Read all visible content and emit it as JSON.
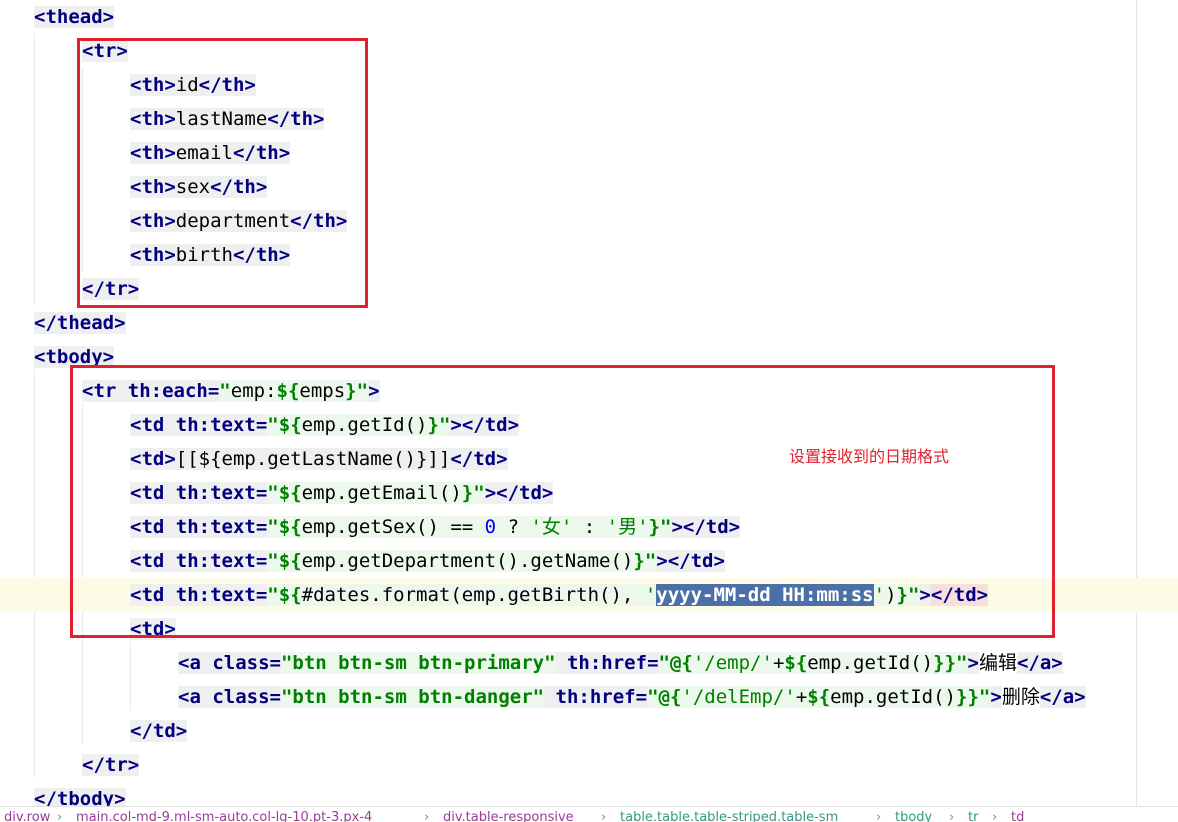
{
  "editor": {
    "annotation": "设置接收到的日期格式",
    "lines": [
      {
        "tokens": [
          {
            "t": "<thead>",
            "c": "tg"
          }
        ]
      },
      {
        "tokens": [
          {
            "t": "<tr>",
            "c": "tg"
          }
        ]
      },
      {
        "tokens": [
          {
            "t": "<th>",
            "c": "tg"
          },
          {
            "t": "id",
            "c": "pt"
          },
          {
            "t": "</th>",
            "c": "tg"
          }
        ]
      },
      {
        "tokens": [
          {
            "t": "<th>",
            "c": "tg"
          },
          {
            "t": "lastName",
            "c": "pt"
          },
          {
            "t": "</th>",
            "c": "tg"
          }
        ]
      },
      {
        "tokens": [
          {
            "t": "<th>",
            "c": "tg"
          },
          {
            "t": "email",
            "c": "pt"
          },
          {
            "t": "</th>",
            "c": "tg"
          }
        ]
      },
      {
        "tokens": [
          {
            "t": "<th>",
            "c": "tg"
          },
          {
            "t": "sex",
            "c": "pt"
          },
          {
            "t": "</th>",
            "c": "tg"
          }
        ]
      },
      {
        "tokens": [
          {
            "t": "<th>",
            "c": "tg"
          },
          {
            "t": "department",
            "c": "pt"
          },
          {
            "t": "</th>",
            "c": "tg"
          }
        ]
      },
      {
        "tokens": [
          {
            "t": "<th>",
            "c": "tg"
          },
          {
            "t": "birth",
            "c": "pt"
          },
          {
            "t": "</th>",
            "c": "tg"
          }
        ]
      },
      {
        "tokens": [
          {
            "t": "</tr>",
            "c": "tg"
          }
        ]
      },
      {
        "tokens": [
          {
            "t": "</thead>",
            "c": "tg"
          }
        ]
      },
      {
        "tokens": [
          {
            "t": "<tbody>",
            "c": "tg"
          }
        ]
      },
      {
        "tokens": [
          {
            "t": "<tr ",
            "c": "tg"
          },
          {
            "t": "th:each",
            "c": "at"
          },
          {
            "t": "=",
            "c": "at"
          },
          {
            "t": "\"",
            "c": "st"
          },
          {
            "t": "emp:",
            "c": "ex"
          },
          {
            "t": "${",
            "c": "st"
          },
          {
            "t": "emps",
            "c": "ex"
          },
          {
            "t": "}",
            "c": "st"
          },
          {
            "t": "\"",
            "c": "st"
          },
          {
            "t": ">",
            "c": "tg"
          }
        ]
      },
      {
        "tokens": [
          {
            "t": "<td ",
            "c": "tg"
          },
          {
            "t": "th:text",
            "c": "at"
          },
          {
            "t": "=",
            "c": "at"
          },
          {
            "t": "\"",
            "c": "st"
          },
          {
            "t": "${",
            "c": "st"
          },
          {
            "t": "emp.getId()",
            "c": "ex"
          },
          {
            "t": "}",
            "c": "st"
          },
          {
            "t": "\"",
            "c": "st"
          },
          {
            "t": "></td>",
            "c": "tg"
          }
        ]
      },
      {
        "tokens": [
          {
            "t": "<td>",
            "c": "tg"
          },
          {
            "t": "[[${emp.getLastName()}]]",
            "c": "pt"
          },
          {
            "t": "</td>",
            "c": "tg"
          }
        ]
      },
      {
        "tokens": [
          {
            "t": "<td ",
            "c": "tg"
          },
          {
            "t": "th:text",
            "c": "at"
          },
          {
            "t": "=",
            "c": "at"
          },
          {
            "t": "\"",
            "c": "st"
          },
          {
            "t": "${",
            "c": "st"
          },
          {
            "t": "emp.getEmail()",
            "c": "ex"
          },
          {
            "t": "}",
            "c": "st"
          },
          {
            "t": "\"",
            "c": "st"
          },
          {
            "t": "></td>",
            "c": "tg"
          }
        ]
      },
      {
        "tokens": [
          {
            "t": "<td ",
            "c": "tg"
          },
          {
            "t": "th:text",
            "c": "at"
          },
          {
            "t": "=",
            "c": "at"
          },
          {
            "t": "\"",
            "c": "st"
          },
          {
            "t": "${",
            "c": "st"
          },
          {
            "t": "emp.getSex() == ",
            "c": "ex"
          },
          {
            "t": "0",
            "c": "nm"
          },
          {
            "t": " ? ",
            "c": "ex"
          },
          {
            "t": "'女'",
            "c": "ch"
          },
          {
            "t": " : ",
            "c": "ex"
          },
          {
            "t": "'男'",
            "c": "ch"
          },
          {
            "t": "}",
            "c": "st"
          },
          {
            "t": "\"",
            "c": "st"
          },
          {
            "t": "></td>",
            "c": "tg"
          }
        ]
      },
      {
        "tokens": [
          {
            "t": "<td ",
            "c": "tg"
          },
          {
            "t": "th:text",
            "c": "at"
          },
          {
            "t": "=",
            "c": "at"
          },
          {
            "t": "\"",
            "c": "st"
          },
          {
            "t": "${",
            "c": "st"
          },
          {
            "t": "emp.getDepartment().getName()",
            "c": "ex"
          },
          {
            "t": "}",
            "c": "st"
          },
          {
            "t": "\"",
            "c": "st"
          },
          {
            "t": "></td>",
            "c": "tg"
          }
        ]
      },
      {
        "tokens": [
          {
            "t": "<td ",
            "c": "tg"
          },
          {
            "t": "th:text",
            "c": "at"
          },
          {
            "t": "=",
            "c": "at"
          },
          {
            "t": "\"",
            "c": "st"
          },
          {
            "t": "${",
            "c": "st"
          },
          {
            "t": "#dates.format(emp.getBirth(), ",
            "c": "ex"
          },
          {
            "t": "'",
            "c": "ch"
          },
          {
            "t": "yyyy-MM-dd HH:mm:ss",
            "c": "sel"
          },
          {
            "t": "'",
            "c": "ch"
          },
          {
            "t": ")",
            "c": "ex"
          },
          {
            "t": "}",
            "c": "st"
          },
          {
            "t": "\"",
            "c": "st"
          },
          {
            "t": ">",
            "c": "tgm"
          },
          {
            "t": "</td>",
            "c": "tgr"
          }
        ]
      },
      {
        "tokens": [
          {
            "t": "<td>",
            "c": "tg"
          }
        ]
      },
      {
        "tokens": [
          {
            "t": "<a ",
            "c": "tg"
          },
          {
            "t": "class",
            "c": "at"
          },
          {
            "t": "=",
            "c": "at"
          },
          {
            "t": "\"btn btn-sm btn-primary\"",
            "c": "st"
          },
          {
            "t": " ",
            "c": "tg"
          },
          {
            "t": "th:href",
            "c": "at"
          },
          {
            "t": "=",
            "c": "at"
          },
          {
            "t": "\"",
            "c": "st"
          },
          {
            "t": "@{",
            "c": "st"
          },
          {
            "t": "'/emp/'",
            "c": "ch"
          },
          {
            "t": "+",
            "c": "ex"
          },
          {
            "t": "${",
            "c": "st"
          },
          {
            "t": "emp.getId()",
            "c": "ex"
          },
          {
            "t": "}",
            "c": "st"
          },
          {
            "t": "}",
            "c": "st"
          },
          {
            "t": "\"",
            "c": "st"
          },
          {
            "t": ">",
            "c": "tg"
          },
          {
            "t": "编辑",
            "c": "tx"
          },
          {
            "t": "</a>",
            "c": "tg"
          }
        ]
      },
      {
        "tokens": [
          {
            "t": "<a ",
            "c": "tg"
          },
          {
            "t": "class",
            "c": "at"
          },
          {
            "t": "=",
            "c": "at"
          },
          {
            "t": "\"btn btn-sm btn-danger\"",
            "c": "st"
          },
          {
            "t": " ",
            "c": "tg"
          },
          {
            "t": "th:href",
            "c": "at"
          },
          {
            "t": "=",
            "c": "at"
          },
          {
            "t": "\"",
            "c": "st"
          },
          {
            "t": "@{",
            "c": "st"
          },
          {
            "t": "'/delEmp/'",
            "c": "ch"
          },
          {
            "t": "+",
            "c": "ex"
          },
          {
            "t": "${",
            "c": "st"
          },
          {
            "t": "emp.getId()",
            "c": "ex"
          },
          {
            "t": "}",
            "c": "st"
          },
          {
            "t": "}",
            "c": "st"
          },
          {
            "t": "\"",
            "c": "st"
          },
          {
            "t": ">",
            "c": "tg"
          },
          {
            "t": "删除",
            "c": "tx"
          },
          {
            "t": "</a>",
            "c": "tg"
          }
        ]
      },
      {
        "tokens": [
          {
            "t": "</td>",
            "c": "tg"
          }
        ]
      },
      {
        "tokens": [
          {
            "t": "</tr>",
            "c": "tg"
          }
        ]
      },
      {
        "tokens": [
          {
            "t": "</tbody>",
            "c": "tg"
          }
        ]
      }
    ]
  },
  "breadcrumb": {
    "items": [
      {
        "text": "div.row",
        "color": "#9a3c9a"
      },
      {
        "text": "main.col-md-9.ml-sm-auto.col-lg-10.pt-3.px-4",
        "color": "#9a3c9a"
      },
      {
        "text": "div.table-responsive",
        "color": "#9a3c9a"
      },
      {
        "text": "table.table.table-striped.table-sm",
        "color": "#2f9a86"
      },
      {
        "text": "tbody",
        "color": "#2f9a86"
      },
      {
        "text": "tr",
        "color": "#2f9a86"
      },
      {
        "text": "td",
        "color": "#9a3c9a"
      }
    ],
    "separator": "›"
  }
}
